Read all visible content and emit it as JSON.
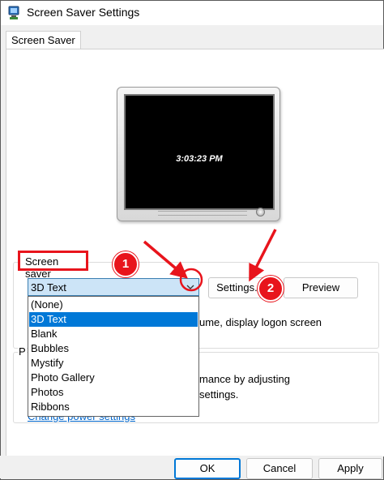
{
  "window": {
    "title": "Screen Saver Settings"
  },
  "tabs": [
    {
      "label": "Screen Saver"
    }
  ],
  "preview": {
    "clock_text": "3:03:23 PM"
  },
  "screensaver": {
    "group_label": "Screen saver",
    "selected": "3D Text",
    "settings_label": "Settings...",
    "preview_label": "Preview",
    "options": [
      "(None)",
      "3D Text",
      "Blank",
      "Bubbles",
      "Mystify",
      "Photo Gallery",
      "Photos",
      "Ribbons"
    ]
  },
  "obscured": {
    "logon_text": "ume, display logon screen",
    "power_line1": "mance by adjusting",
    "power_line2": "settings.",
    "power_group_letter": "P",
    "power_link": "Change power settings"
  },
  "footer": {
    "ok": "OK",
    "cancel": "Cancel",
    "apply": "Apply"
  },
  "annotations": {
    "badge1": "1",
    "badge2": "2",
    "color": "#e8141c"
  }
}
